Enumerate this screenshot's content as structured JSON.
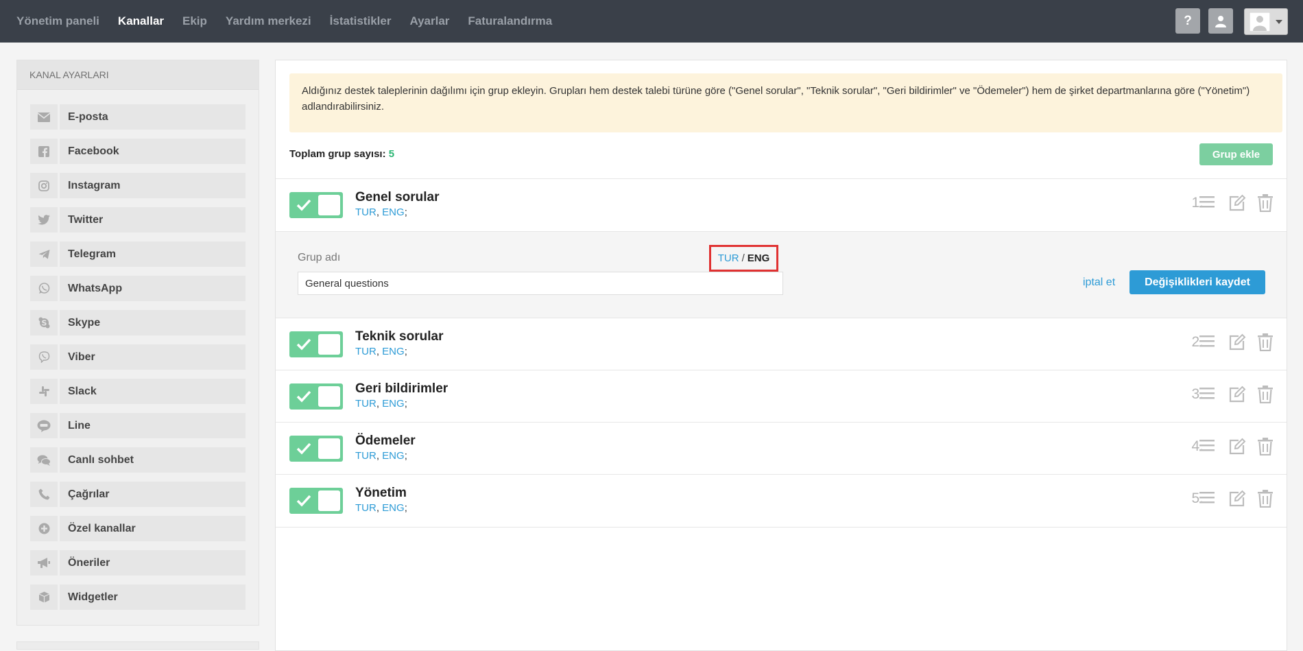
{
  "nav": {
    "items": [
      "Yönetim paneli",
      "Kanallar",
      "Ekip",
      "Yardım merkezi",
      "İstatistikler",
      "Ayarlar",
      "Faturalandırma"
    ],
    "active": "Kanallar",
    "help_label": "?",
    "icons": [
      "question-icon",
      "user-icon",
      "avatar-icon",
      "caret-down-icon"
    ]
  },
  "sidebar": {
    "title": "KANAL AYARLARI",
    "items": [
      {
        "label": "E-posta",
        "icon": "envelope-icon"
      },
      {
        "label": "Facebook",
        "icon": "facebook-icon"
      },
      {
        "label": "Instagram",
        "icon": "instagram-icon"
      },
      {
        "label": "Twitter",
        "icon": "twitter-icon"
      },
      {
        "label": "Telegram",
        "icon": "telegram-icon"
      },
      {
        "label": "WhatsApp",
        "icon": "whatsapp-icon"
      },
      {
        "label": "Skype",
        "icon": "skype-icon"
      },
      {
        "label": "Viber",
        "icon": "viber-icon"
      },
      {
        "label": "Slack",
        "icon": "slack-icon"
      },
      {
        "label": "Line",
        "icon": "line-icon"
      },
      {
        "label": "Canlı sohbet",
        "icon": "chat-icon"
      },
      {
        "label": "Çağrılar",
        "icon": "phone-icon"
      },
      {
        "label": "Özel kanallar",
        "icon": "plus-circle-icon"
      },
      {
        "label": "Öneriler",
        "icon": "megaphone-icon"
      },
      {
        "label": "Widgetler",
        "icon": "cube-icon"
      }
    ]
  },
  "main": {
    "notice": "Aldığınız destek taleplerinin dağılımı için grup ekleyin. Grupları hem destek talebi türüne göre (\"Genel sorular\", \"Teknik sorular\", \"Geri bildirimler\" ve \"Ödemeler\") hem de şirket departmanlarına göre (\"Yönetim\") adlandırabilirsiniz.",
    "total_label": "Toplam grup sayısı:",
    "total_value": "5",
    "add_button": "Grup ekle",
    "groups": [
      {
        "name": "Genel sorular",
        "lang1": "TUR",
        "lang2": "ENG",
        "index": "1.",
        "enabled": true
      },
      {
        "name": "Teknik sorular",
        "lang1": "TUR",
        "lang2": "ENG",
        "index": "2.",
        "enabled": true
      },
      {
        "name": "Geri bildirimler",
        "lang1": "TUR",
        "lang2": "ENG",
        "index": "3.",
        "enabled": true
      },
      {
        "name": "Ödemeler",
        "lang1": "TUR",
        "lang2": "ENG",
        "index": "4.",
        "enabled": true
      },
      {
        "name": "Yönetim",
        "lang1": "TUR",
        "lang2": "ENG",
        "index": "5.",
        "enabled": true
      }
    ],
    "edit": {
      "label": "Grup adı",
      "lang_tur": "TUR",
      "lang_sep": "/",
      "lang_eng": "ENG",
      "input_value": "General questions",
      "cancel": "iptal et",
      "save": "Değişiklikleri kaydet"
    },
    "colors": {
      "accent_blue": "#2d9bd6",
      "toggle_green": "#6dcf98",
      "highlight_red": "#e03131"
    }
  }
}
